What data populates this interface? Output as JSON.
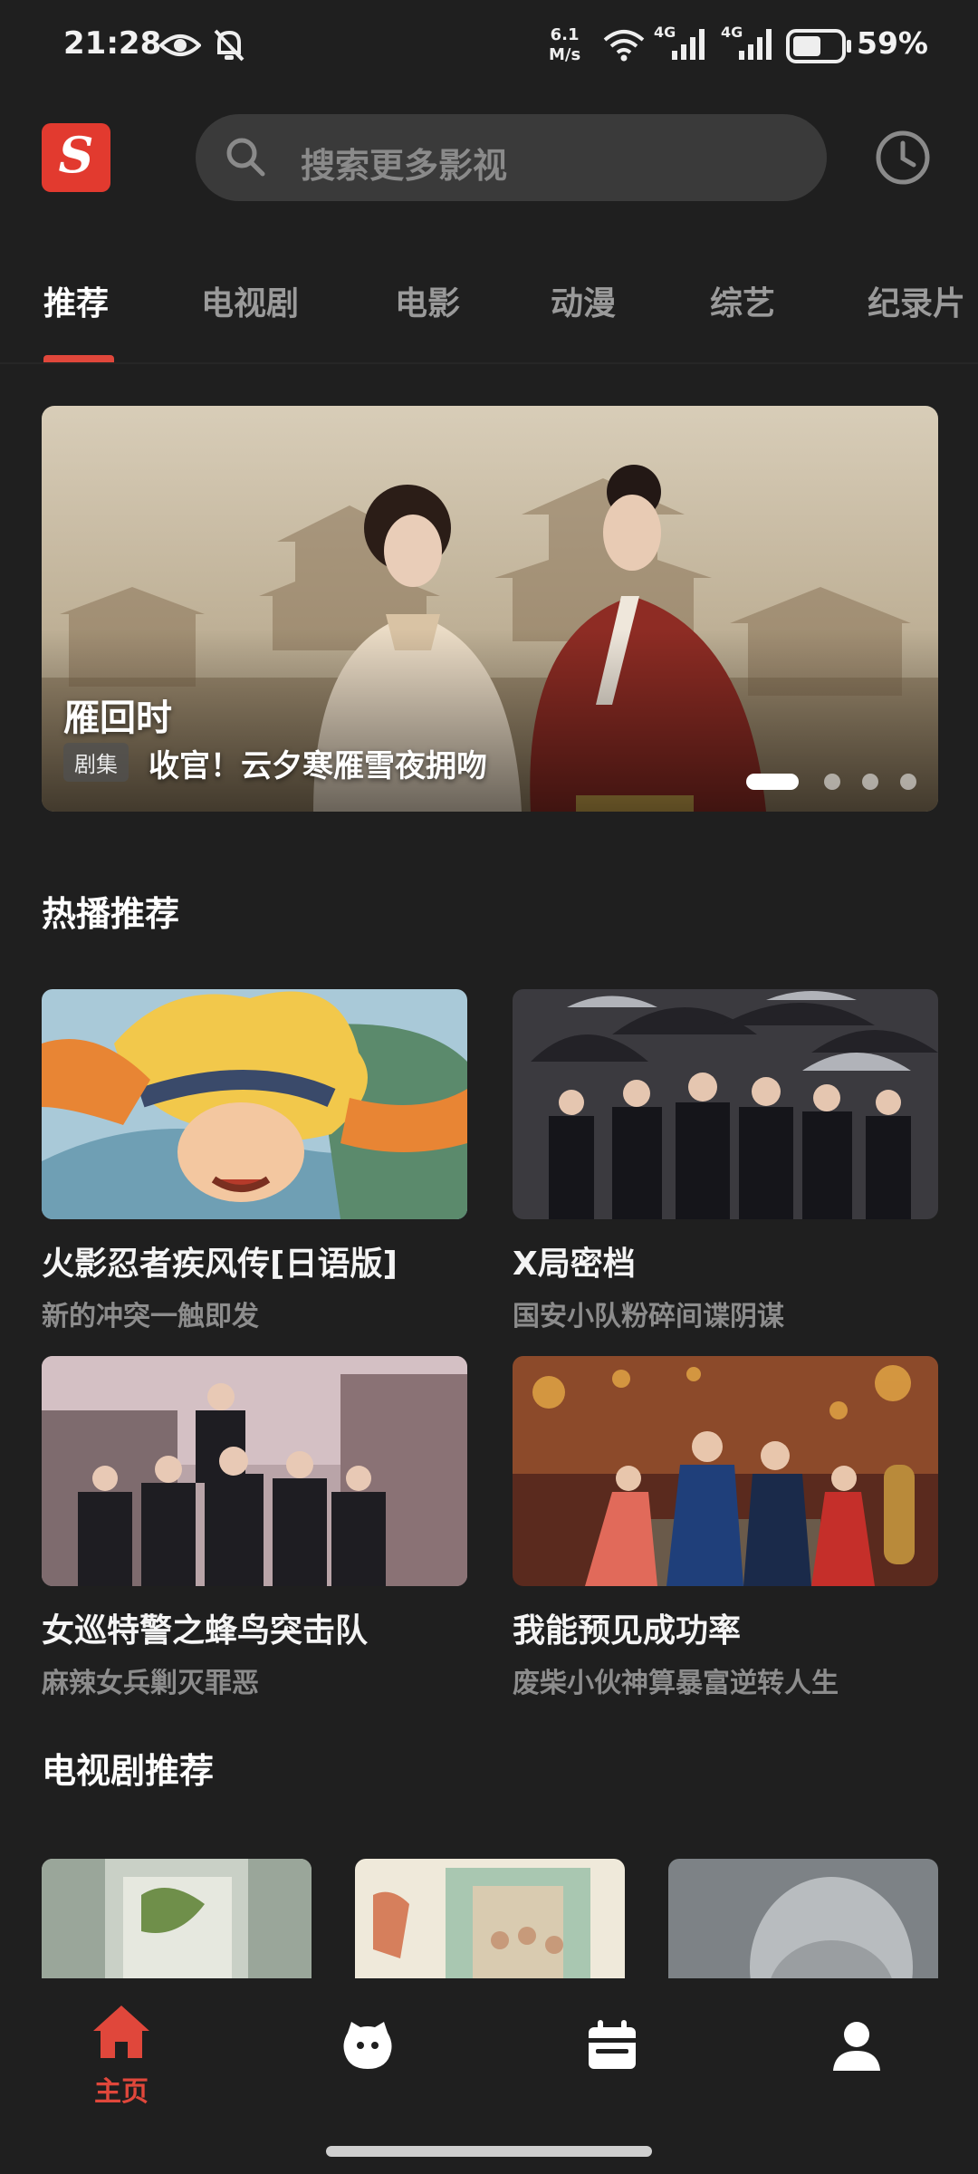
{
  "status_bar": {
    "time": "21:28",
    "net_speed_value": "6.1",
    "net_speed_unit": "M/s",
    "signal_1": "4G",
    "signal_2": "4G",
    "battery": "59%"
  },
  "header": {
    "logo_letter": "S",
    "search_placeholder": "搜索更多影视",
    "history_icon": "clock-icon"
  },
  "tabs": [
    {
      "label": "推荐",
      "active": true
    },
    {
      "label": "电视剧",
      "active": false
    },
    {
      "label": "电影",
      "active": false
    },
    {
      "label": "动漫",
      "active": false
    },
    {
      "label": "综艺",
      "active": false
    },
    {
      "label": "纪录片",
      "active": false
    }
  ],
  "banner": {
    "title": "雁回时",
    "tag": "剧集",
    "subtitle": "收官！云夕寒雁雪夜拥吻",
    "slide_count": 4,
    "active_slide": 1
  },
  "sections": {
    "hot": "热播推荐",
    "tv": "电视剧推荐"
  },
  "hot_cards": [
    {
      "name": "火影忍者疾风传[日语版]",
      "desc": "新的冲突一触即发"
    },
    {
      "name": "X局密档",
      "desc": "国安小队粉碎间谍阴谋"
    },
    {
      "name": "女巡特警之蜂鸟突击队",
      "desc": "麻辣女兵剿灭罪恶"
    },
    {
      "name": "我能预见成功率",
      "desc": "废柴小伙神算暴富逆转人生"
    }
  ],
  "bottom_nav": {
    "home_label": "主页",
    "items": [
      "home-icon",
      "cat-face-icon",
      "calendar-icon",
      "profile-icon"
    ]
  },
  "colors": {
    "accent": "#e0473b",
    "background": "#1f1f1f",
    "search_bg": "#3a3a3a"
  }
}
